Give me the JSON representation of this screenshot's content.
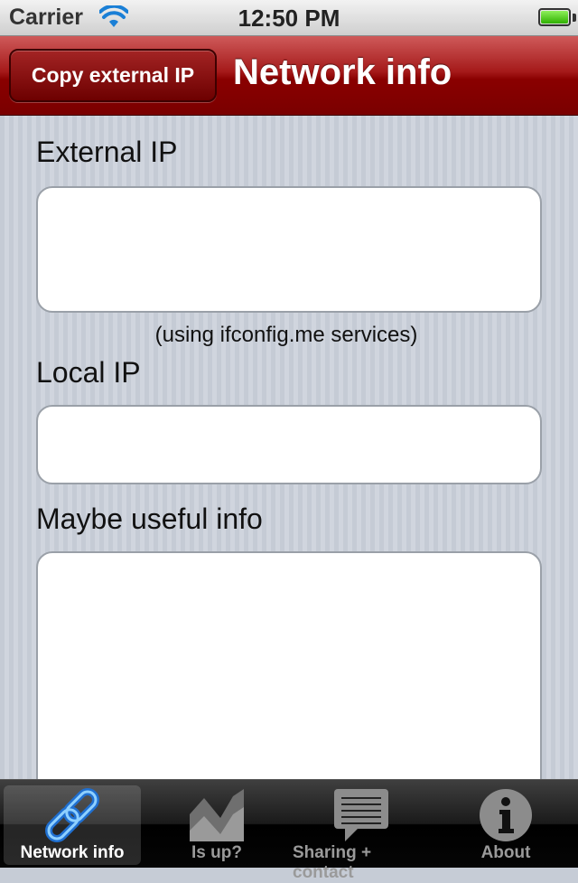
{
  "status_bar": {
    "carrier": "Carrier",
    "time": "12:50 PM",
    "battery_level": 1.0
  },
  "nav_bar": {
    "button_label": "Copy external IP",
    "title": "Network info",
    "color": "#8a0000"
  },
  "form": {
    "external_ip": {
      "label": "External IP",
      "value": ""
    },
    "external_ip_hint": "(using ifconfig.me services)",
    "local_ip": {
      "label": "Local IP",
      "value": ""
    },
    "useful_info": {
      "label": "Maybe useful info",
      "value": ""
    }
  },
  "tab_bar": {
    "tabs": [
      {
        "label": "Network info",
        "icon": "link-chain-icon",
        "active": true
      },
      {
        "label": "Is up?",
        "icon": "chart-icon",
        "active": false
      },
      {
        "label": "Sharing + contact",
        "icon": "speech-bubble-icon",
        "active": false
      },
      {
        "label": "About",
        "icon": "info-icon",
        "active": false
      }
    ]
  }
}
